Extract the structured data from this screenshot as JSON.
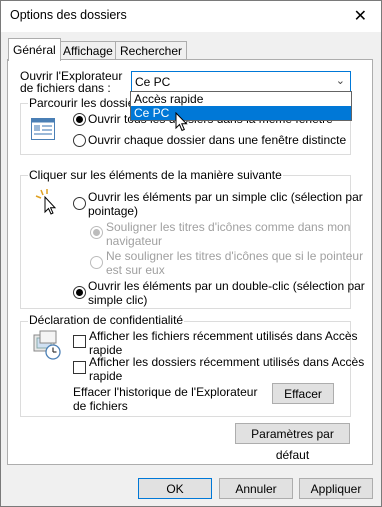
{
  "window": {
    "title": "Options des dossiers",
    "close_glyph": "✕"
  },
  "tabs": [
    {
      "label": "Général",
      "active": true
    },
    {
      "label": "Affichage",
      "active": false
    },
    {
      "label": "Rechercher",
      "active": false
    }
  ],
  "open_explorer": {
    "label_line1": "Ouvrir l'Explorateur",
    "label_line2": "de fichiers dans :",
    "selected": "Ce PC",
    "options": [
      "Accès rapide",
      "Ce PC"
    ],
    "highlighted": "Ce PC"
  },
  "browse_folders": {
    "label": "Parcourir les dossiers",
    "option_same": "Ouvrir tous les dossiers dans la même fenêtre",
    "option_new": "Ouvrir chaque dossier dans une fenêtre distincte",
    "selected": "same"
  },
  "click_items": {
    "label": "Cliquer sur les éléments de la manière suivante",
    "single_line1": "Ouvrir les éléments par un simple clic (sélection par",
    "single_line2": "pointage)",
    "underline_browser_line1": "Souligner les titres d'icônes comme dans mon",
    "underline_browser_line2": "navigateur",
    "underline_hover_line1": "Ne souligner les titres d'icônes que si le pointeur",
    "underline_hover_line2": "est sur eux",
    "double_line1": "Ouvrir les éléments par un double-clic (sélection par",
    "double_line2": "simple clic)",
    "selected": "double"
  },
  "privacy": {
    "label": "Déclaration de confidentialité",
    "recent_files_line1": "Afficher les fichiers récemment utilisés dans Accès",
    "recent_files_line2": "rapide",
    "recent_folders_line1": "Afficher les dossiers récemment utilisés dans Accès",
    "recent_folders_line2": "rapide",
    "clear_line1": "Effacer l'historique de l'Explorateur",
    "clear_line2": "de fichiers",
    "clear_button": "Effacer"
  },
  "defaults_button": "Paramètres par défaut",
  "footer": {
    "ok": "OK",
    "cancel": "Annuler",
    "apply": "Appliquer"
  },
  "colors": {
    "accent": "#0078d7",
    "dialog_bg": "#f0f0f0",
    "panel_bg": "#ffffff"
  }
}
